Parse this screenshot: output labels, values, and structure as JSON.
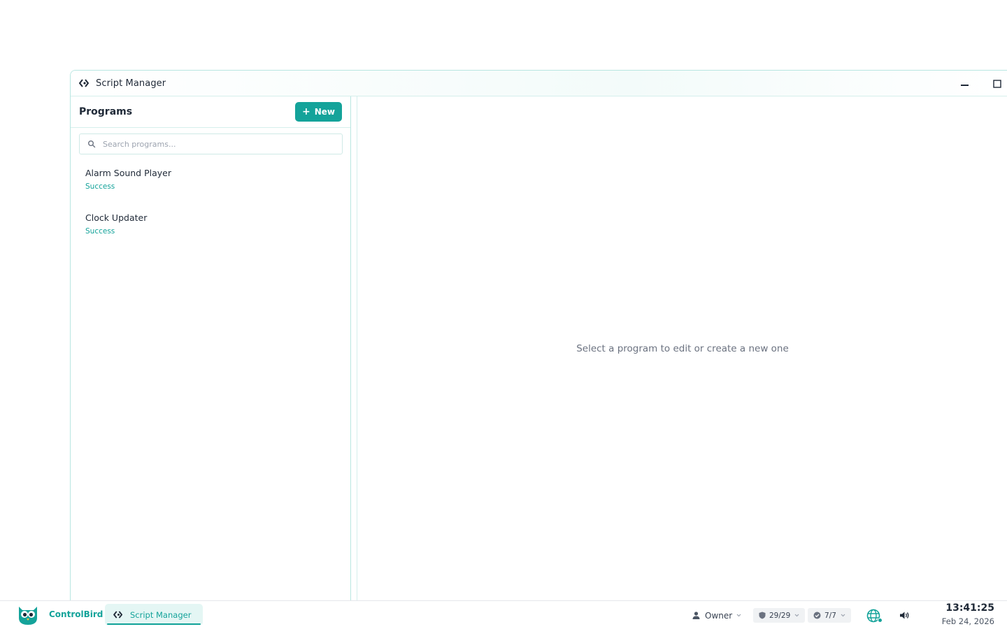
{
  "window": {
    "title": "Script Manager"
  },
  "sidebar": {
    "heading": "Programs",
    "new_button_label": "New",
    "search_placeholder": "Search programs...",
    "programs": [
      {
        "name": "Alarm Sound Player",
        "status": "Success"
      },
      {
        "name": "Clock Updater",
        "status": "Success"
      }
    ]
  },
  "main": {
    "empty_message": "Select a program to edit or create a new one"
  },
  "taskbar": {
    "brand": "ControlBird",
    "open_app": "Script Manager",
    "user": "Owner",
    "security_count": "29/29",
    "checks_count": "7/7",
    "time": "13:41:25",
    "date": "Feb 24, 2026"
  },
  "colors": {
    "accent": "#14a39a",
    "accent_light": "#e4f6f4",
    "border": "#b8e6e1"
  }
}
